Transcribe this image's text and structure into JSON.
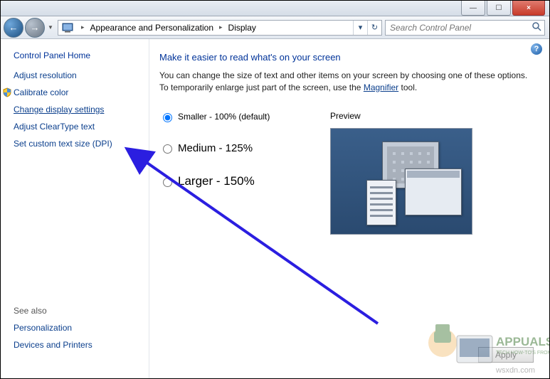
{
  "titlebar": {
    "min": "—",
    "max": "☐",
    "close": "×"
  },
  "navbar": {
    "back": "←",
    "forward": "→",
    "dropdown": "▼",
    "refresh": "↻",
    "addr_dropdown": "▾"
  },
  "breadcrumb": {
    "segment1": "Appearance and Personalization",
    "segment2": "Display"
  },
  "search": {
    "placeholder": "Search Control Panel"
  },
  "sidebar": {
    "home": "Control Panel Home",
    "links": [
      "Adjust resolution",
      "Calibrate color",
      "Change display settings",
      "Adjust ClearType text",
      "Set custom text size (DPI)"
    ],
    "seealso_head": "See also",
    "seealso": [
      "Personalization",
      "Devices and Printers"
    ]
  },
  "main": {
    "title": "Make it easier to read what's on your screen",
    "desc_pre": "You can change the size of text and other items on your screen by choosing one of these options. To temporarily enlarge just part of the screen, use the ",
    "desc_link": "Magnifier",
    "desc_post": " tool.",
    "options": {
      "smaller": "Smaller - 100% (default)",
      "medium": "Medium - 125%",
      "larger": "Larger - 150%"
    },
    "preview_label": "Preview",
    "apply": "Apply"
  },
  "help": "?",
  "watermark_line1": "APPUALS",
  "watermark_line2": "TECH HOW-TO'S FROM",
  "watermark_site": "wsxdn.com"
}
